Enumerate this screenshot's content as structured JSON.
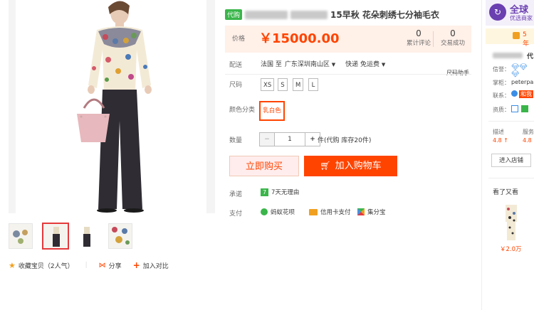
{
  "gallery": {
    "thumb_count": 4,
    "actions": {
      "favorite": "收藏宝贝（2人气）",
      "share": "分享",
      "compare": "加入对比"
    }
  },
  "product": {
    "tag": "代购",
    "title": "15早秋 花朵刺绣七分袖毛衣",
    "price_label": "价格",
    "price": "￥15000.00",
    "reviews_count": "0",
    "reviews_label": "累计评论",
    "sales_count": "0",
    "sales_label": "交易成功",
    "ship_label": "配送",
    "ship_from": "法国 至",
    "ship_to": "广东深圳南山区",
    "ship_method": "快递 免运费",
    "size_helper": "尺码助手",
    "size_label": "尺码",
    "sizes": [
      "XS",
      "S",
      "M",
      "L"
    ],
    "color_label": "颜色分类",
    "color_value": "乳白色",
    "qty_label": "数量",
    "qty_minus": "−",
    "qty_value": "1",
    "qty_plus": "+",
    "qty_unit": "件(代购 库存20件)",
    "buy_now": "立即购买",
    "add_cart": "加入购物车",
    "promise_label": "承诺",
    "promise_value": "7天无理由",
    "pay_label": "支付",
    "pay_options": [
      "蚂蚁花呗",
      "信用卡支付",
      "集分宝"
    ]
  },
  "right_panel": {
    "header_title": "全球",
    "header_sub": "优选商家",
    "badge": "5 年",
    "shop_suffix": "代",
    "credit_label": "信誉：",
    "owner_label": "掌柜：",
    "owner_value": "peterpa",
    "contact_label": "联系：",
    "contact_value": "和我",
    "qual_label": "资质：",
    "desc_label": "描述",
    "desc_score": "4.8 ↑",
    "serv_label": "服务",
    "serv_score": "4.8",
    "enter_shop": "进入店铺",
    "seen_label": "看了又看",
    "rec_price": "￥2.0万"
  },
  "colors": {
    "accent": "#ff4400",
    "price_bg": "#fff0e8"
  }
}
